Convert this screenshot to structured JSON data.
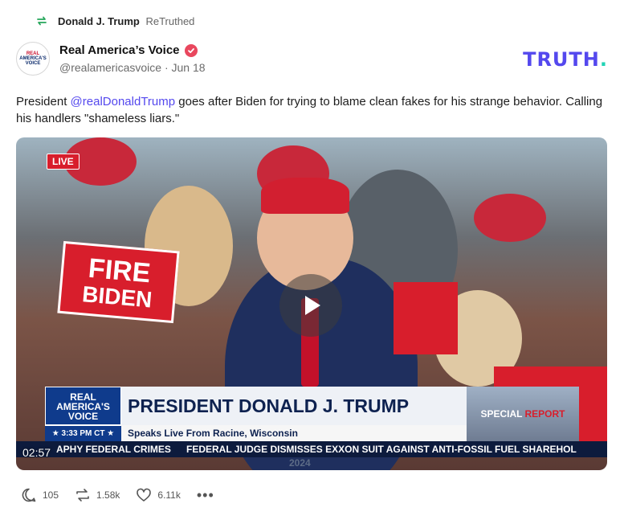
{
  "retruth": {
    "icon": "retruth-icon",
    "name": "Donald J. Trump",
    "suffix": "ReTruthed"
  },
  "author": {
    "avatar_lines": [
      "REAL",
      "AMERICA'S",
      "VOICE"
    ],
    "display_name": "Real America’s Voice",
    "verified_icon": "verified-badge-icon",
    "handle": "@realamericasvoice",
    "date": "Jun 18"
  },
  "brand": {
    "logo_text": "TRUTH",
    "logo_dot": ".",
    "color": "#5448ee",
    "dot_color": "#20d3b4"
  },
  "post": {
    "text_before": "President ",
    "mention": "@realDonaldTrump",
    "text_after": " goes after Biden for trying to blame clean fakes for his strange behavior. Calling his handlers \"shameless liars.\""
  },
  "video": {
    "live_badge": "LIVE",
    "sign_text": [
      "FIRE",
      "BIDEN"
    ],
    "network_lines": [
      "REAL",
      "AMERICA'S",
      "VOICE"
    ],
    "time": "★ 3:33 PM CT ★",
    "headline": "PRESIDENT DONALD J. TRUMP",
    "subheadline": "Speaks Live From Racine, Wisconsin",
    "special": "SPECIAL",
    "report": "REPORT",
    "ticker_left": "APHY FEDERAL CRIMES",
    "ticker_right": "FEDERAL JUDGE DISMISSES EXXON SUIT AGAINST ANTI-FOSSIL FUEL SHAREHOL",
    "ticker_year": "2024",
    "duration": "02:57",
    "play_icon": "play-icon"
  },
  "actions": {
    "replies": "105",
    "retruths": "1.58k",
    "likes": "6.11k",
    "more": "•••"
  }
}
